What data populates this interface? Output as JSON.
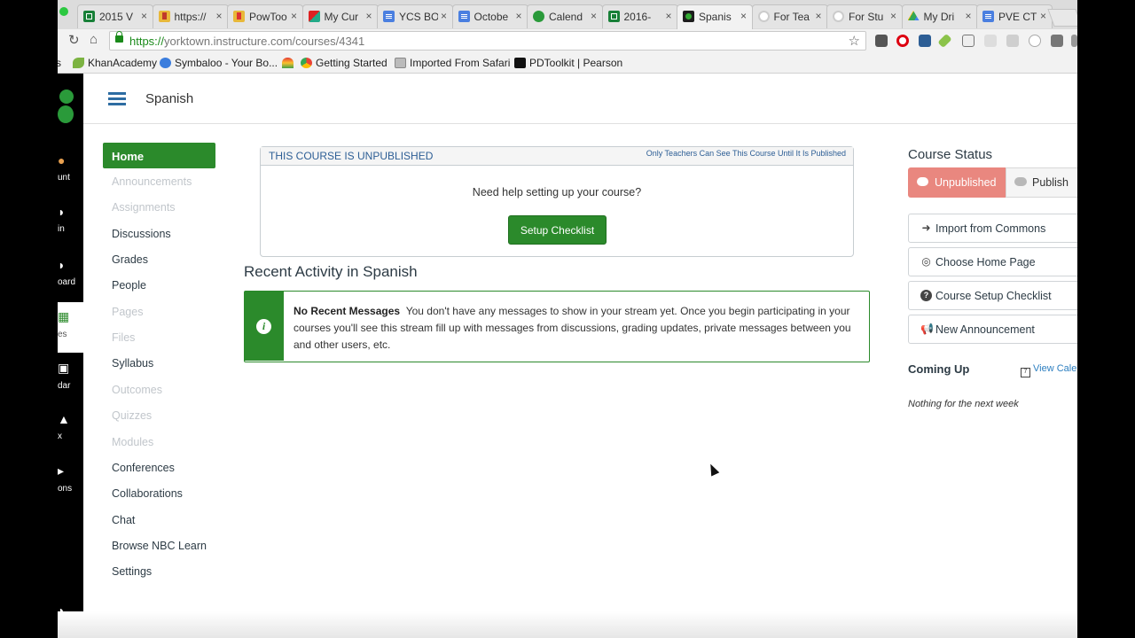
{
  "browser": {
    "tabs": [
      {
        "label": "2015 V",
        "icon": "spreadsheet-icon"
      },
      {
        "label": "https://",
        "icon": "bookmark-icon"
      },
      {
        "label": "PowToo",
        "icon": "powtoon-icon"
      },
      {
        "label": "My Cur",
        "icon": "curriculum-icon"
      },
      {
        "label": "YCS BO",
        "icon": "doc-icon"
      },
      {
        "label": "Octobe",
        "icon": "doc-icon"
      },
      {
        "label": "Calend",
        "icon": "paw-icon"
      },
      {
        "label": "2016-",
        "icon": "spreadsheet-icon"
      },
      {
        "label": "Spanis",
        "icon": "canvas-icon",
        "active": true
      },
      {
        "label": "For Tea",
        "icon": "rainbow-icon"
      },
      {
        "label": "For Stu",
        "icon": "rainbow-icon"
      },
      {
        "label": "My Dri",
        "icon": "drive-icon"
      },
      {
        "label": "PVE CT",
        "icon": "doc-icon"
      }
    ],
    "url_scheme": "https://",
    "url_rest": "yorktown.instructure.com/courses/4341",
    "bookmarks": [
      {
        "label": "s"
      },
      {
        "label": "KhanAcademy"
      },
      {
        "label": "Symbaloo - Your Bo..."
      },
      {
        "label": ""
      },
      {
        "label": "Getting Started"
      },
      {
        "label": "Imported From Safari"
      },
      {
        "label": "PDToolkit | Pearson"
      }
    ]
  },
  "global_nav": {
    "items": [
      {
        "label": "unt"
      },
      {
        "label": "in"
      },
      {
        "label": "oard"
      },
      {
        "label": "es"
      },
      {
        "label": "dar"
      },
      {
        "label": "x"
      },
      {
        "label": "ons"
      }
    ]
  },
  "course": {
    "name": "Spanish"
  },
  "course_nav": [
    {
      "label": "Home",
      "state": "active"
    },
    {
      "label": "Announcements",
      "state": "dim"
    },
    {
      "label": "Assignments",
      "state": "dim"
    },
    {
      "label": "Discussions",
      "state": "normal"
    },
    {
      "label": "Grades",
      "state": "normal"
    },
    {
      "label": "People",
      "state": "normal"
    },
    {
      "label": "Pages",
      "state": "dim"
    },
    {
      "label": "Files",
      "state": "dim"
    },
    {
      "label": "Syllabus",
      "state": "normal"
    },
    {
      "label": "Outcomes",
      "state": "dim"
    },
    {
      "label": "Quizzes",
      "state": "dim"
    },
    {
      "label": "Modules",
      "state": "dim"
    },
    {
      "label": "Conferences",
      "state": "normal"
    },
    {
      "label": "Collaborations",
      "state": "normal"
    },
    {
      "label": "Chat",
      "state": "normal"
    },
    {
      "label": "Browse NBC Learn",
      "state": "normal"
    },
    {
      "label": "Settings",
      "state": "normal"
    }
  ],
  "main": {
    "unpublished_title": "THIS COURSE IS UNPUBLISHED",
    "unpublished_note": "Only Teachers Can See This Course Until It Is Published",
    "help_text": "Need help setting up your course?",
    "setup_button": "Setup Checklist",
    "recent_heading": "Recent Activity in Spanish",
    "no_messages_title": "No Recent Messages",
    "no_messages_body": "You don't have any messages to show in your stream yet. Once you begin participating in your courses you'll see this stream fill up with messages from discussions, grading updates, private messages between you and other users, etc."
  },
  "sidebar": {
    "status_title": "Course Status",
    "unpublished_label": "Unpublished",
    "publish_label": "Publish",
    "actions": [
      {
        "label": "Import from Commons",
        "icon": "import-icon"
      },
      {
        "label": "Choose Home Page",
        "icon": "target-icon"
      },
      {
        "label": "Course Setup Checklist",
        "icon": "question-icon"
      },
      {
        "label": "New Announcement",
        "icon": "megaphone-icon"
      }
    ],
    "coming_up": "Coming Up",
    "view_calendar": "View Cale",
    "nothing_next_week": "Nothing for the next week"
  },
  "colors": {
    "accent_green": "#2b8a2b",
    "unpublished_red": "#e9877f",
    "link_blue": "#2d7fc0"
  }
}
